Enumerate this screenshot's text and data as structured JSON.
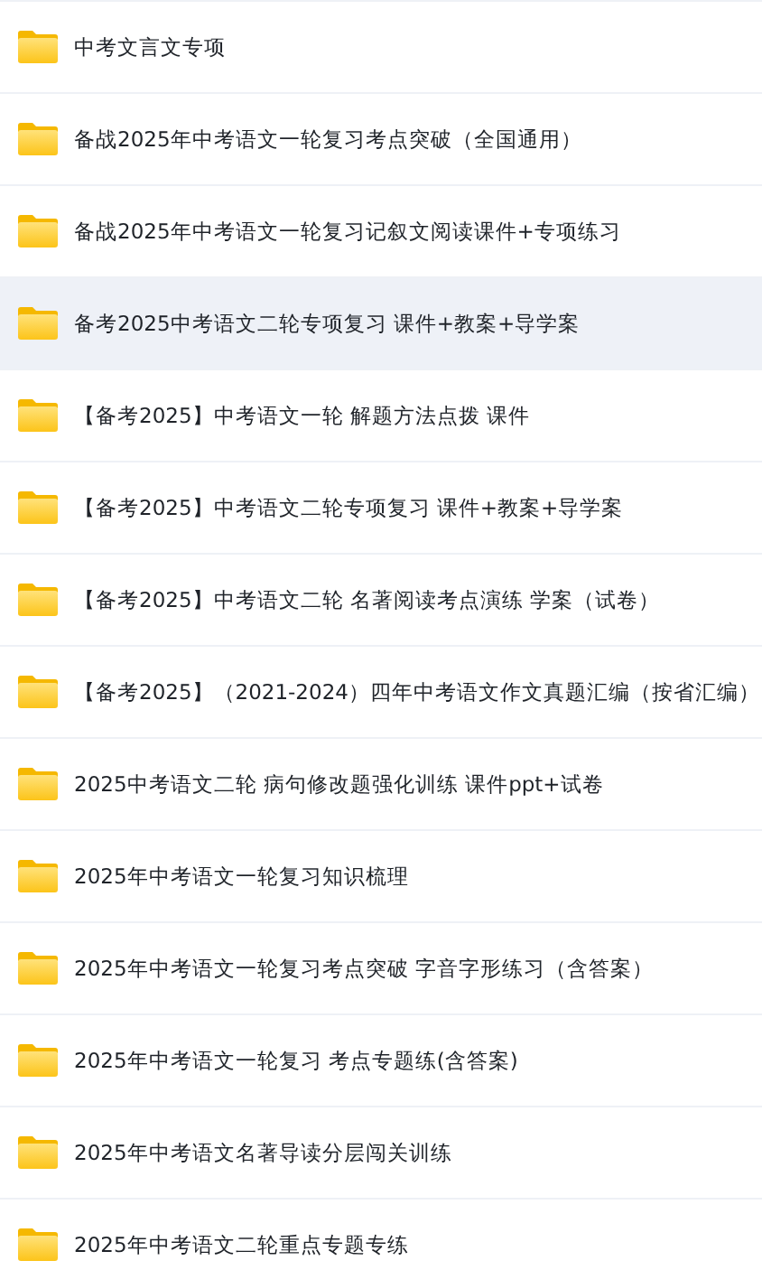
{
  "folders": [
    {
      "name": "中考文言文专项",
      "selected": false
    },
    {
      "name": "备战2025年中考语文一轮复习考点突破（全国通用）",
      "selected": false
    },
    {
      "name": "备战2025年中考语文一轮复习记叙文阅读课件+专项练习",
      "selected": false
    },
    {
      "name": "备考2025中考语文二轮专项复习 课件+教案+导学案",
      "selected": true
    },
    {
      "name": "【备考2025】中考语文一轮 解题方法点拨 课件",
      "selected": false
    },
    {
      "name": "【备考2025】中考语文二轮专项复习 课件+教案+导学案",
      "selected": false
    },
    {
      "name": "【备考2025】中考语文二轮 名著阅读考点演练 学案（试卷）",
      "selected": false
    },
    {
      "name": "【备考2025】（2021-2024）四年中考语文作文真题汇编（按省汇编）",
      "selected": false
    },
    {
      "name": "2025中考语文二轮 病句修改题强化训练 课件ppt+试卷",
      "selected": false
    },
    {
      "name": "2025年中考语文一轮复习知识梳理",
      "selected": false
    },
    {
      "name": "2025年中考语文一轮复习考点突破 字音字形练习（含答案）",
      "selected": false
    },
    {
      "name": "2025年中考语文一轮复习 考点专题练(含答案)",
      "selected": false
    },
    {
      "name": "2025年中考语文名著导读分层闯关训练",
      "selected": false
    },
    {
      "name": "2025年中考语文二轮重点专题专练",
      "selected": false
    }
  ]
}
